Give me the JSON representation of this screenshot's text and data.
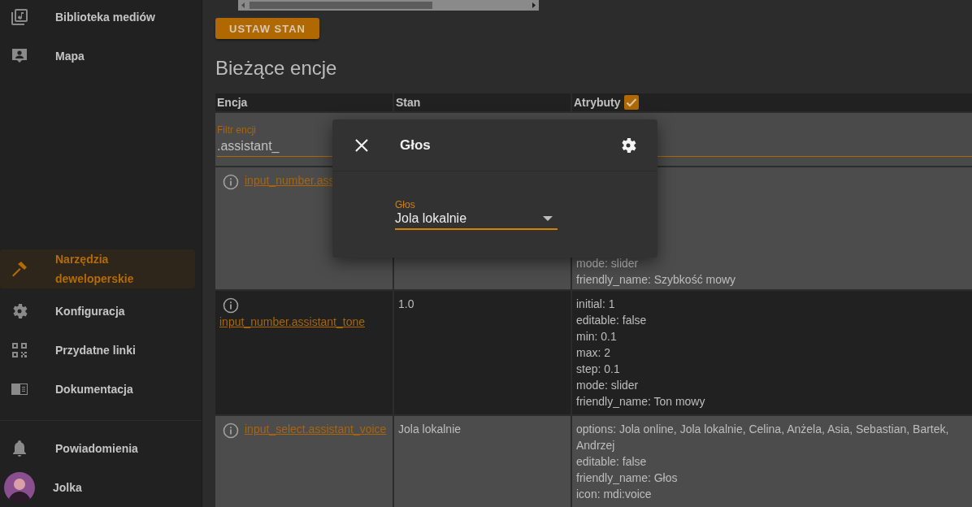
{
  "sidebar": {
    "items": [
      {
        "label": "Biblioteka mediów",
        "selected": false
      },
      {
        "label": "Mapa",
        "selected": false
      },
      {
        "label": "Narzędzia deweloperskie",
        "selected": true
      },
      {
        "label": "Konfiguracja",
        "selected": false
      },
      {
        "label": "Przydatne linki",
        "selected": false
      },
      {
        "label": "Dokumentacja",
        "selected": false
      }
    ],
    "notifications": {
      "label": "Powiadomienia"
    },
    "user": {
      "name": "Jolka"
    }
  },
  "set_state_button": "USTAW STAN",
  "heading": "Bieżące encje",
  "table": {
    "columns": [
      {
        "label": "Encja"
      },
      {
        "label": "Stan"
      },
      {
        "label": "Atrybuty",
        "checked": true
      }
    ],
    "filter": {
      "label": "Filtr encji",
      "value": ".assistant_"
    },
    "rows": [
      {
        "entity": "input_number.ass",
        "attributes": [
          "mode: slider",
          "friendly_name: Szybkość mowy"
        ]
      },
      {
        "entity": "input_number.assistant_tone",
        "state": "1.0",
        "attributes": [
          "initial: 1",
          "editable: false",
          "min: 0.1",
          "max: 2",
          "step: 0.1",
          "mode: slider",
          "friendly_name: Ton mowy"
        ]
      },
      {
        "entity": "input_select.assistant_voice",
        "state": "Jola lokalnie",
        "attributes": [
          "options: Jola online, Jola lokalnie, Celina, Anżela, Asia, Sebastian, Bartek, Andrzej",
          "editable: false",
          "friendly_name: Głos",
          "icon: mdi:voice"
        ]
      }
    ]
  },
  "dialog": {
    "title": "Głos",
    "select": {
      "label": "Głos",
      "value": "Jola lokalnie"
    }
  }
}
